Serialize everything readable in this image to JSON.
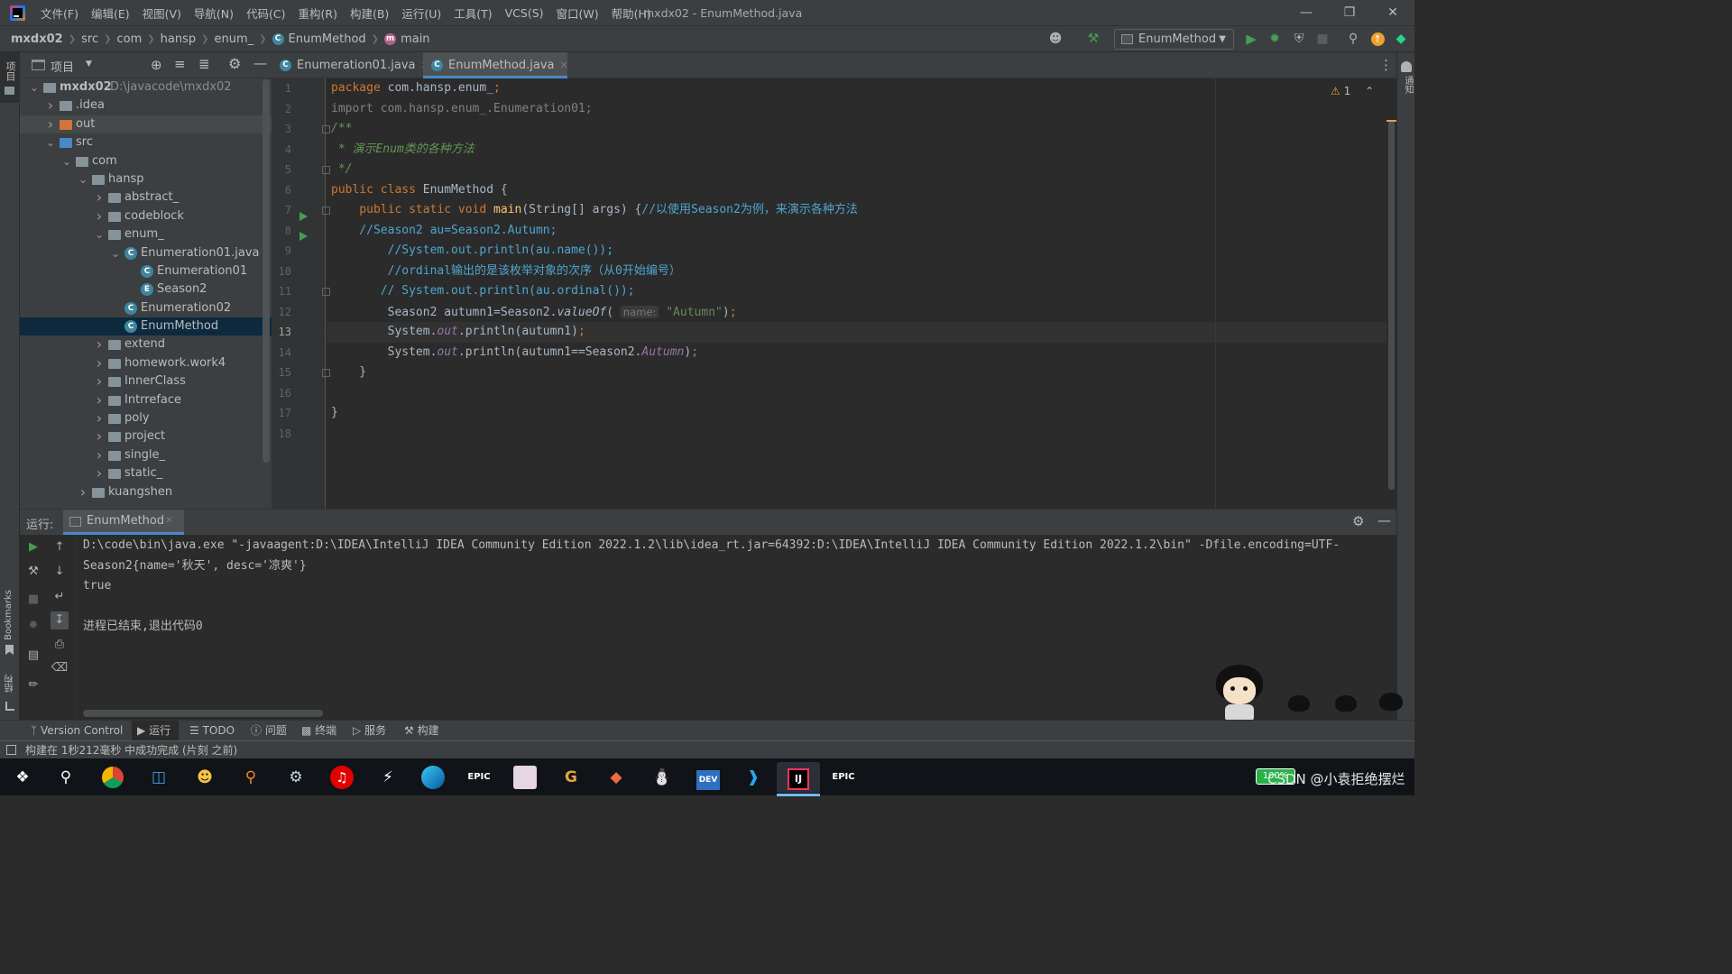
{
  "window": {
    "title": "mxdx02 - EnumMethod.java",
    "menu": [
      "文件(F)",
      "编辑(E)",
      "视图(V)",
      "导航(N)",
      "代码(C)",
      "重构(R)",
      "构建(B)",
      "运行(U)",
      "工具(T)",
      "VCS(S)",
      "窗口(W)",
      "帮助(H)"
    ]
  },
  "breadcrumb": [
    "mxdx02",
    "src",
    "com",
    "hansp",
    "enum_",
    "EnumMethod",
    "main"
  ],
  "toolbar": {
    "run_config": "EnumMethod",
    "accent": "#499c54"
  },
  "project": {
    "header_label": "项目",
    "tree": [
      {
        "label": "mxdx02",
        "path": "D:\\javacode\\mxdx02",
        "depth": 0,
        "expanded": true,
        "type": "module"
      },
      {
        "label": ".idea",
        "depth": 1,
        "expanded": false,
        "type": "folder"
      },
      {
        "label": "out",
        "depth": 1,
        "expanded": false,
        "type": "folder-excluded"
      },
      {
        "label": "src",
        "depth": 1,
        "expanded": true,
        "type": "source-folder"
      },
      {
        "label": "com",
        "depth": 2,
        "expanded": true,
        "type": "package"
      },
      {
        "label": "hansp",
        "depth": 3,
        "expanded": true,
        "type": "package"
      },
      {
        "label": "abstract_",
        "depth": 4,
        "expanded": false,
        "type": "package"
      },
      {
        "label": "codeblock",
        "depth": 4,
        "expanded": false,
        "type": "package"
      },
      {
        "label": "enum_",
        "depth": 4,
        "expanded": true,
        "type": "package"
      },
      {
        "label": "Enumeration01.java",
        "depth": 5,
        "expanded": true,
        "type": "java-file"
      },
      {
        "label": "Enumeration01",
        "depth": 6,
        "type": "class"
      },
      {
        "label": "Season2",
        "depth": 6,
        "type": "enum"
      },
      {
        "label": "Enumeration02",
        "depth": 5,
        "type": "class"
      },
      {
        "label": "EnumMethod",
        "depth": 5,
        "type": "class",
        "selected": true
      },
      {
        "label": "extend",
        "depth": 4,
        "expanded": false,
        "type": "package"
      },
      {
        "label": "homework.work4",
        "depth": 4,
        "expanded": false,
        "type": "package"
      },
      {
        "label": "InnerClass",
        "depth": 4,
        "expanded": false,
        "type": "package"
      },
      {
        "label": "Intrreface",
        "depth": 4,
        "expanded": false,
        "type": "package"
      },
      {
        "label": "poly",
        "depth": 4,
        "expanded": false,
        "type": "package"
      },
      {
        "label": "project",
        "depth": 4,
        "expanded": false,
        "type": "package"
      },
      {
        "label": "single_",
        "depth": 4,
        "expanded": false,
        "type": "package"
      },
      {
        "label": "static_",
        "depth": 4,
        "expanded": false,
        "type": "package"
      },
      {
        "label": "kuangshen",
        "depth": 3,
        "expanded": false,
        "type": "package"
      }
    ]
  },
  "editor": {
    "tabs": [
      {
        "label": "Enumeration01.java",
        "active": false
      },
      {
        "label": "EnumMethod.java",
        "active": true
      }
    ],
    "warning_count": "1",
    "current_line": 13,
    "param_hint": "name:",
    "code": {
      "l1_a": "package",
      "l1_b": " com.hansp.enum_",
      "l1_c": ";",
      "l2": "import com.hansp.enum_.Enumeration01;",
      "l3": "/**",
      "l4": " * 演示Enum类的各种方法",
      "l5": " */",
      "l6_a": "public class",
      "l6_b": " EnumMethod {",
      "l7_a": "    public static void",
      "l7_b": " main",
      "l7_c": "(String[] args) {",
      "l7_d": "//以使用Season2为例，来演示各种方法",
      "l8": "    //Season2 au=Season2.Autumn;",
      "l9": "        //System.out.println(au.name());",
      "l10": "        //ordinal输出的是该枚举对象的次序（从0开始编号）",
      "l11": "       // System.out.println(au.ordinal());",
      "l12_a": "        Season2 autumn1=Season2.",
      "l12_b": "valueOf",
      "l12_c": "(",
      "l12_d": "\"Autumn\"",
      "l12_e": ")",
      "l12_f": ";",
      "l13_a": "        System.",
      "l13_b": "out",
      "l13_c": ".println(autumn1)",
      "l13_d": ";",
      "l14_a": "        System.",
      "l14_b": "out",
      "l14_c": ".println(autumn1==Season2.",
      "l14_d": "Autumn",
      "l14_e": ")",
      "l14_f": ";",
      "l15": "    }",
      "l17": "}"
    }
  },
  "run": {
    "label": "运行:",
    "tab": "EnumMethod",
    "output": [
      "D:\\code\\bin\\java.exe \"-javaagent:D:\\IDEA\\IntelliJ IDEA Community Edition 2022.1.2\\lib\\idea_rt.jar=64392:D:\\IDEA\\IntelliJ IDEA Community Edition 2022.1.2\\bin\" -Dfile.encoding=UTF-",
      "Season2{name='秋天', desc='凉爽'}",
      "true",
      "",
      "进程已结束,退出代码0"
    ]
  },
  "bottom_tabs": [
    "Version Control",
    "运行",
    "TODO",
    "问题",
    "终端",
    "服务",
    "构建"
  ],
  "side_labels": {
    "project": "项目",
    "bookmarks": "Bookmarks",
    "structure": "结构",
    "notifications": "通知"
  },
  "status": {
    "text": "构建在 1秒212毫秒 中成功完成 (片刻 之前)"
  },
  "taskbar": {
    "apps": [
      "start",
      "search",
      "chrome",
      "files",
      "game",
      "everything",
      "steam",
      "netease-music",
      "vpn",
      "edge",
      "epic",
      "anime-game",
      "gmail-like",
      "git",
      "qq",
      "dev-cpp",
      "vscode",
      "intellij",
      "epic"
    ],
    "battery": "100%",
    "tray_badge": "CSDN @小袁拒绝摆烂"
  }
}
